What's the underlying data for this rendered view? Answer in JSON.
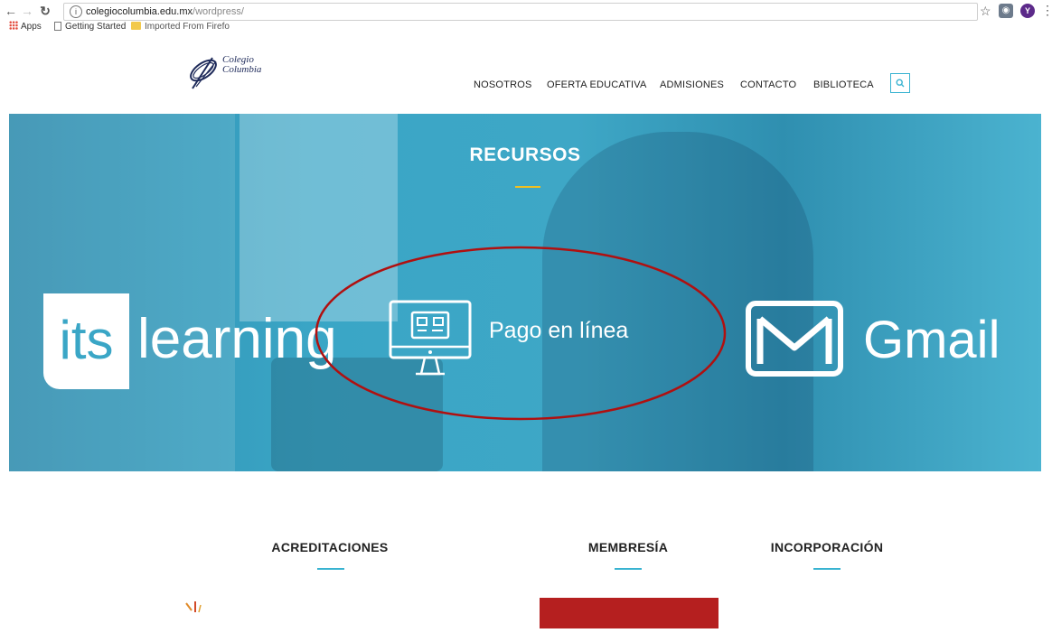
{
  "browser": {
    "url_domain": "colegiocolumbia.edu.mx",
    "url_path": "/wordpress/",
    "bookmarks": [
      {
        "label": "Apps",
        "icon": "apps-grid-icon"
      },
      {
        "label": "Getting Started",
        "icon": "page-icon"
      },
      {
        "label": "Imported From Firefo",
        "icon": "folder-icon"
      }
    ],
    "profile_initial": "Y"
  },
  "site": {
    "logo_line1": "Colegio",
    "logo_line2": "Columbia",
    "nav": [
      "NOSOTROS",
      "OFERTA EDUCATIVA",
      "ADMISIONES",
      "CONTACTO",
      "BIBLIOTECA"
    ]
  },
  "hero": {
    "title": "RECURSOS",
    "its_label": "its",
    "learning_label": "learning",
    "pago_label": "Pago en línea",
    "gmail_label": "Gmail",
    "accent_color": "#3aa6c6",
    "annotation_color": "#b01010"
  },
  "sections": {
    "acreditaciones": "ACREDITACIONES",
    "membresia": "MEMBRESÍA",
    "incorporacion": "INCORPORACIÓN"
  }
}
